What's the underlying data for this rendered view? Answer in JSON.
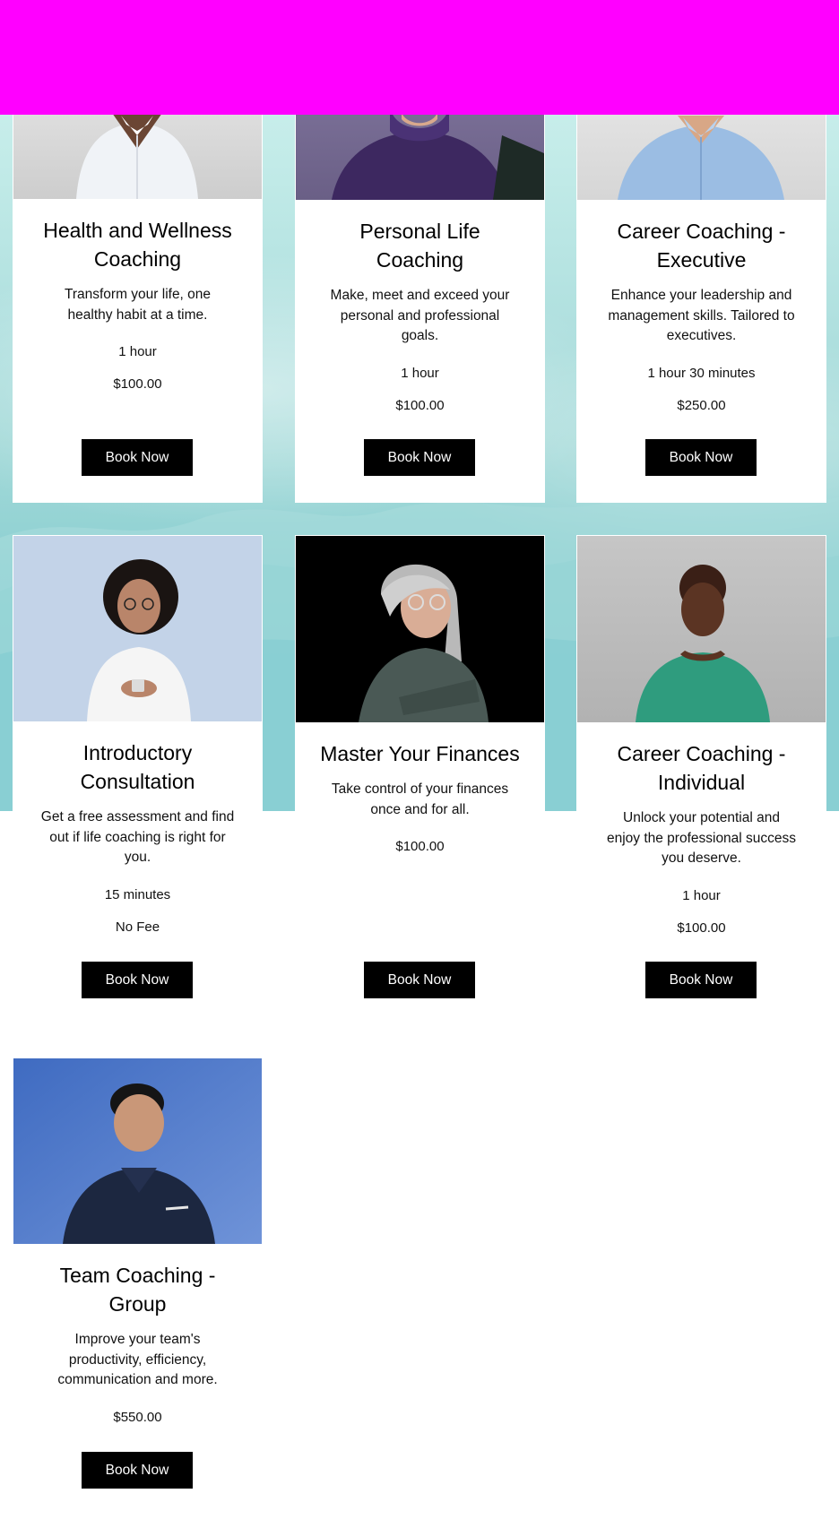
{
  "services": [
    {
      "title": "Health and Wellness Coaching",
      "title_lines": [
        "Health and Wellness",
        "Coaching"
      ],
      "description": "Transform your life, one healthy habit at a time.",
      "description_lines": [
        "Transform your life, one",
        "healthy habit at a time."
      ],
      "duration": "1 hour",
      "price": "$100.00",
      "button_label": "Book Now"
    },
    {
      "title": "Personal Life Coaching",
      "title_lines": [
        "Personal Life",
        "Coaching"
      ],
      "description": "Make, meet and exceed your personal and professional goals.",
      "description_lines": [
        "Make, meet and exceed your",
        "personal and professional",
        "goals."
      ],
      "duration": "1 hour",
      "price": "$100.00",
      "button_label": "Book Now"
    },
    {
      "title": "Career Coaching - Executive",
      "title_lines": [
        "Career Coaching -",
        "Executive"
      ],
      "description": "Enhance your leadership and management skills. Tailored to executives.",
      "description_lines": [
        "Enhance your leadership and",
        "management skills. Tailored to",
        "executives."
      ],
      "duration": "1 hour 30 minutes",
      "price": "$250.00",
      "button_label": "Book Now"
    },
    {
      "title": "Introductory Consultation",
      "title_lines": [
        "Introductory",
        "Consultation"
      ],
      "description": "Get a free assessment and find out if life coaching is right for you.",
      "description_lines": [
        "Get a free assessment and find",
        "out if life coaching is right for",
        "you."
      ],
      "duration": "15 minutes",
      "price": "No Fee",
      "button_label": "Book Now"
    },
    {
      "title": "Master Your Finances",
      "title_lines": [
        "Master Your Finances"
      ],
      "description": "Take control of your finances once and for all.",
      "description_lines": [
        "Take control of your finances",
        "once and for all."
      ],
      "price": "$100.00",
      "button_label": "Book Now"
    },
    {
      "title": "Career Coaching - Individual",
      "title_lines": [
        "Career Coaching -",
        "Individual"
      ],
      "description": "Unlock your potential and enjoy the professional success you deserve.",
      "description_lines": [
        "Unlock your potential and",
        "enjoy the professional success",
        "you deserve."
      ],
      "duration": "1 hour",
      "price": "$100.00",
      "button_label": "Book Now"
    },
    {
      "title": "Team Coaching - Group",
      "title_lines": [
        "Team Coaching -",
        "Group"
      ],
      "description": "Improve your team's productivity, efficiency, communication and more.",
      "description_lines": [
        "Improve your team's",
        "productivity, efficiency,",
        "communication and more."
      ],
      "price": "$550.00",
      "button_label": "Book Now"
    }
  ],
  "colors": {
    "header_bar": "#ff00ff",
    "button_bg": "#000000",
    "button_text": "#ffffff",
    "card_bg": "#ffffff"
  }
}
